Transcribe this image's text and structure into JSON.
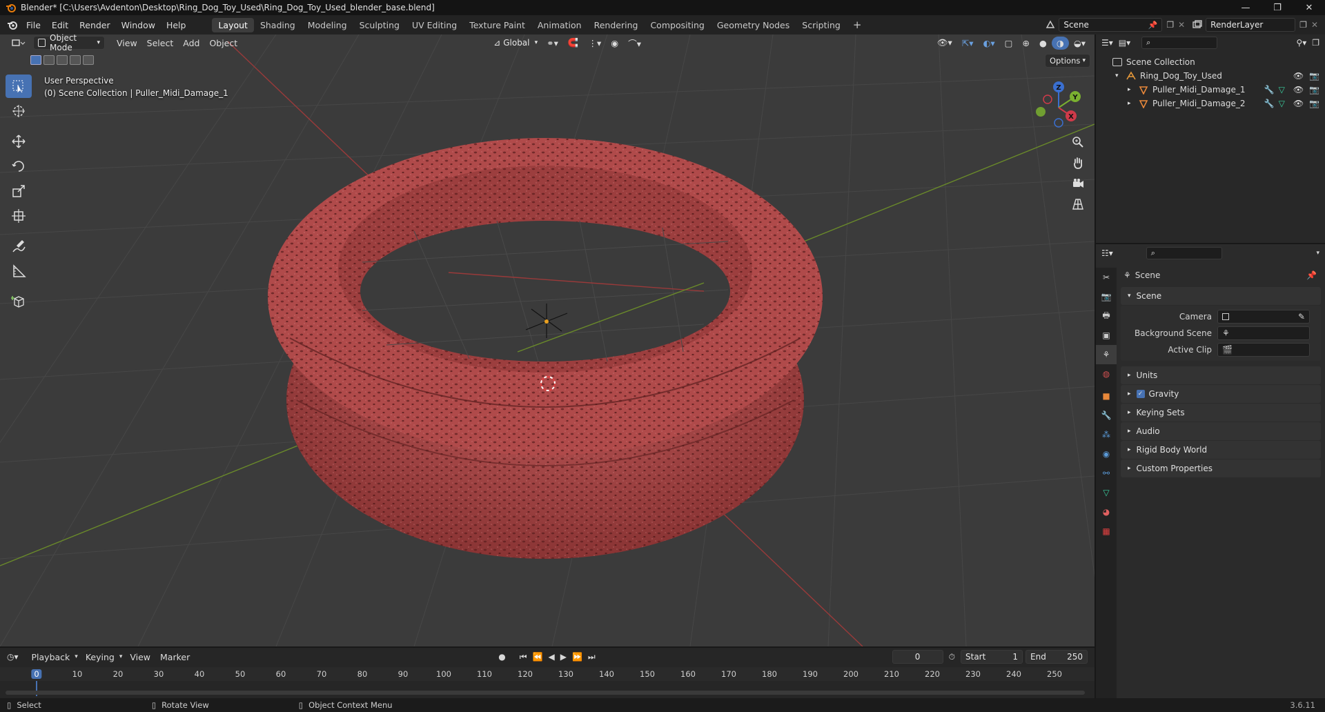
{
  "window": {
    "title": "Blender* [C:\\Users\\Avdenton\\Desktop\\Ring_Dog_Toy_Used\\Ring_Dog_Toy_Used_blender_base.blend]"
  },
  "menus": [
    "File",
    "Edit",
    "Render",
    "Window",
    "Help"
  ],
  "workspaces": [
    "Layout",
    "Shading",
    "Modeling",
    "Sculpting",
    "UV Editing",
    "Texture Paint",
    "Animation",
    "Rendering",
    "Compositing",
    "Geometry Nodes",
    "Scripting"
  ],
  "active_workspace": "Layout",
  "scene_name": "Scene",
  "view_layer": "RenderLayer",
  "viewport": {
    "mode": "Object Mode",
    "header_menus": [
      "View",
      "Select",
      "Add",
      "Object"
    ],
    "transform": "Global",
    "options": "Options",
    "overlay_title": "User Perspective",
    "overlay_sub": "(0) Scene Collection | Puller_Midi_Damage_1",
    "gizmo": {
      "x": "X",
      "y": "Y",
      "z": "Z"
    },
    "mesh_color": "#a84242"
  },
  "outliner": {
    "root": "Scene Collection",
    "collection": "Ring_Dog_Toy_Used",
    "objects": [
      "Puller_Midi_Damage_1",
      "Puller_Midi_Damage_2"
    ]
  },
  "properties": {
    "context": "Scene",
    "section": "Scene",
    "fields": [
      {
        "label": "Camera",
        "value": ""
      },
      {
        "label": "Background Scene",
        "value": ""
      },
      {
        "label": "Active Clip",
        "value": ""
      }
    ],
    "panels": [
      "Units",
      "Gravity",
      "Keying Sets",
      "Audio",
      "Rigid Body World",
      "Custom Properties"
    ]
  },
  "timeline": {
    "menus": [
      "Playback",
      "Keying",
      "View",
      "Marker"
    ],
    "current_frame": "0",
    "start_label": "Start",
    "start": "1",
    "end_label": "End",
    "end": "250",
    "ruler": [
      "0",
      "10",
      "20",
      "30",
      "40",
      "50",
      "60",
      "70",
      "80",
      "90",
      "100",
      "110",
      "120",
      "130",
      "140",
      "150",
      "160",
      "170",
      "180",
      "190",
      "200",
      "210",
      "220",
      "230",
      "240",
      "250"
    ]
  },
  "status": {
    "select": "Select",
    "rotate": "Rotate View",
    "context": "Object Context Menu",
    "version": "3.6.11"
  }
}
